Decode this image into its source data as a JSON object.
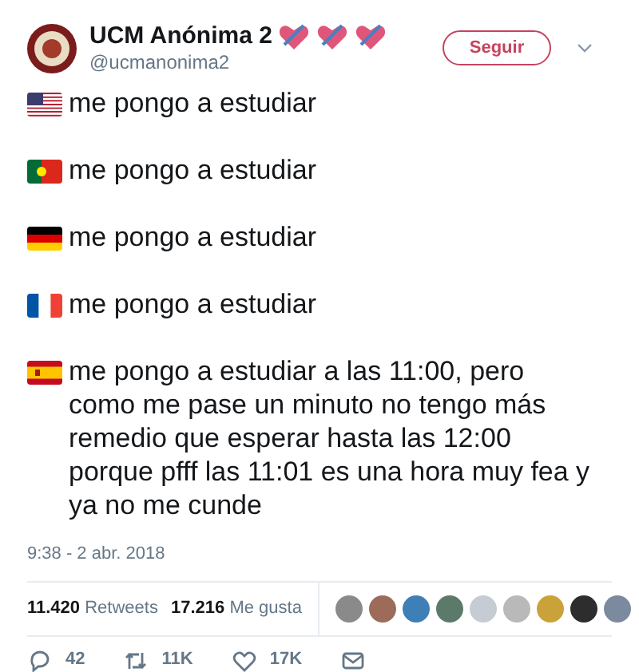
{
  "author": {
    "name": "UCM Anónima 2",
    "handle": "@ucmanonima2"
  },
  "follow_button": "Seguir",
  "paragraphs": [
    {
      "kind": "us",
      "text": "me pongo a estudiar"
    },
    {
      "kind": "pt",
      "text": "me pongo a estudiar"
    },
    {
      "kind": "de",
      "text": "me pongo a estudiar"
    },
    {
      "kind": "fr",
      "text": "me pongo a estudiar"
    },
    {
      "kind": "es",
      "text": "me pongo a estudiar a las 11:00, pero como me pase un minuto no tengo más remedio que esperar hasta las 12:00 porque pfff las 11:01 es una hora muy fea y ya no me cunde"
    }
  ],
  "timestamp": "9:38 - 2 abr. 2018",
  "stats": [
    {
      "count": "11.420",
      "label": "Retweets"
    },
    {
      "count": "17.216",
      "label": "Me gusta"
    }
  ],
  "actions": [
    {
      "kind": "reply",
      "count": "42"
    },
    {
      "kind": "retweet",
      "count": "11K"
    },
    {
      "kind": "like",
      "count": "17K"
    },
    {
      "kind": "message"
    }
  ]
}
